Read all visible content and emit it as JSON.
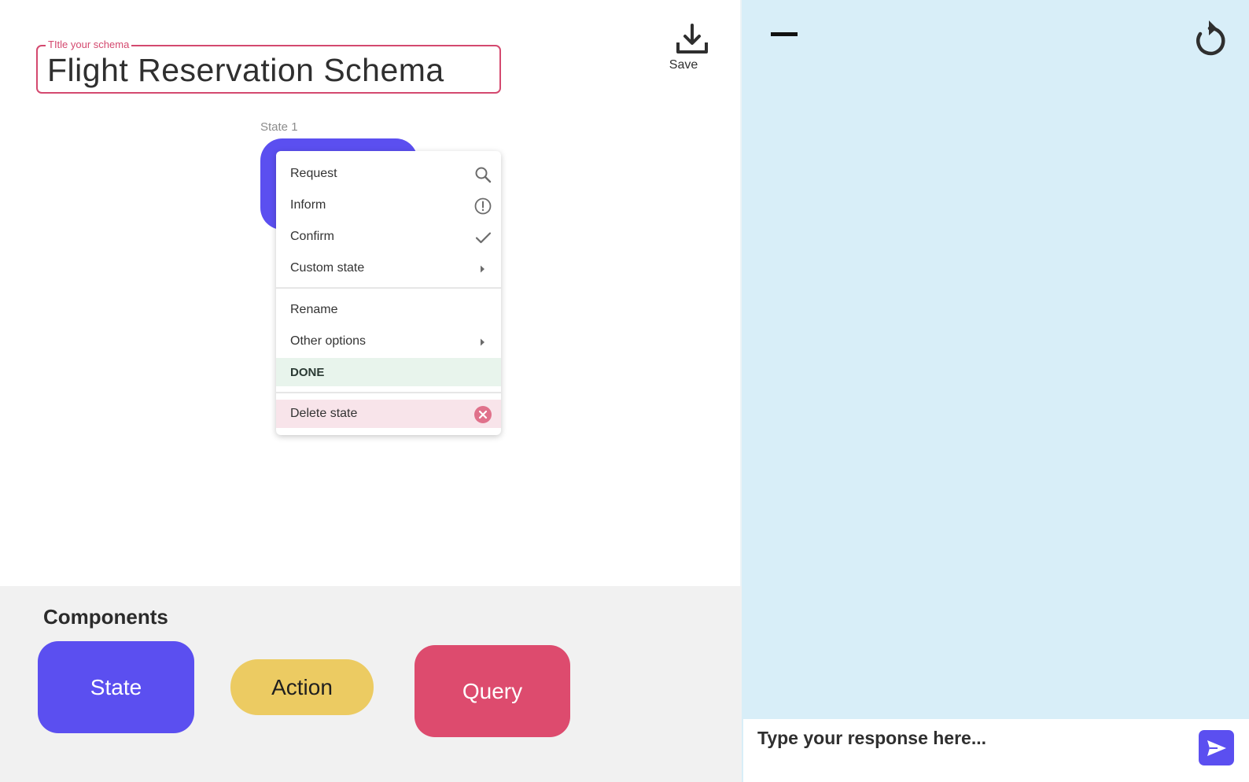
{
  "schema": {
    "title_legend": "TItle your schema",
    "title_value": "Flight Reservation Schema"
  },
  "toolbar": {
    "save_label": "Save",
    "save_icon": "download-icon"
  },
  "canvas": {
    "state_label": "State 1"
  },
  "context_menu": {
    "items": [
      {
        "label": "Request",
        "icon": "search-icon"
      },
      {
        "label": "Inform",
        "icon": "info-circle-icon"
      },
      {
        "label": "Confirm",
        "icon": "check-icon"
      },
      {
        "label": "Custom state",
        "icon": "chevron-right-icon"
      },
      {
        "label": "Rename"
      },
      {
        "label": "Other options",
        "icon": "chevron-right-icon"
      },
      {
        "label": "DONE"
      },
      {
        "label": "Delete state",
        "icon": "close-circle-icon"
      }
    ]
  },
  "components": {
    "title": "Components",
    "state_label": "State",
    "action_label": "Action",
    "query_label": "Query",
    "colors": {
      "state": "#5b4ff0",
      "action": "#eccb62",
      "query": "#dd4b6e"
    }
  },
  "chat": {
    "placeholder": "Type your response here...",
    "minimize_icon": "minus-icon",
    "refresh_icon": "refresh-icon",
    "send_icon": "send-icon",
    "background": "#d8eef8"
  }
}
